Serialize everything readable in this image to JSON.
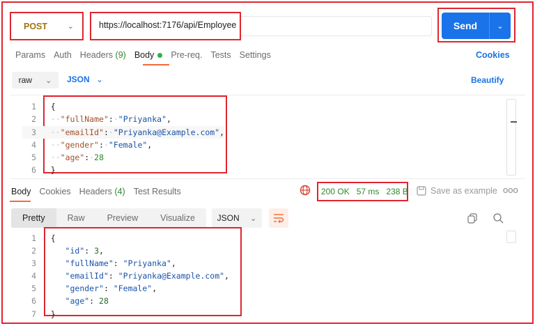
{
  "request": {
    "method": "POST",
    "url": "https://localhost:7176/api/Employee",
    "send_label": "Send"
  },
  "request_tabs": [
    {
      "label": "Params"
    },
    {
      "label": "Auth"
    },
    {
      "label": "Headers",
      "count": "(9)"
    },
    {
      "label": "Body"
    },
    {
      "label": "Pre-req."
    },
    {
      "label": "Tests"
    },
    {
      "label": "Settings"
    }
  ],
  "cookies_label": "Cookies",
  "body_mode": "raw",
  "body_format": "JSON",
  "beautify_label": "Beautify",
  "request_body": [
    {
      "n": "1",
      "text": "{"
    },
    {
      "n": "2",
      "key": "\"fullName\"",
      "val": "\"Priyanka\"",
      "type": "str"
    },
    {
      "n": "3",
      "key": "\"emailId\"",
      "val": "\"Priyanka@Example.com\"",
      "type": "str"
    },
    {
      "n": "4",
      "key": "\"gender\"",
      "val": "\"Female\"",
      "type": "str"
    },
    {
      "n": "5",
      "key": "\"age\"",
      "val": "28",
      "type": "num"
    },
    {
      "n": "6",
      "text": "}"
    }
  ],
  "response_tabs": [
    {
      "label": "Body"
    },
    {
      "label": "Cookies"
    },
    {
      "label": "Headers",
      "count": "(4)"
    },
    {
      "label": "Test Results"
    }
  ],
  "status": {
    "code": "200 OK",
    "time": "57 ms",
    "size": "238 B"
  },
  "save_example_label": "Save as example",
  "more_label": "ooo",
  "view_modes": [
    "Pretty",
    "Raw",
    "Preview",
    "Visualize"
  ],
  "response_format": "JSON",
  "response_body": [
    {
      "n": "1",
      "text": "{"
    },
    {
      "n": "2",
      "key": "\"id\"",
      "val": "3",
      "type": "num"
    },
    {
      "n": "3",
      "key": "\"fullName\"",
      "val": "\"Priyanka\"",
      "type": "str"
    },
    {
      "n": "4",
      "key": "\"emailId\"",
      "val": "\"Priyanka@Example.com\"",
      "type": "str"
    },
    {
      "n": "5",
      "key": "\"gender\"",
      "val": "\"Female\"",
      "type": "str"
    },
    {
      "n": "6",
      "key": "\"age\"",
      "val": "28",
      "type": "num"
    },
    {
      "n": "7",
      "text": "}"
    }
  ],
  "colors": {
    "highlight": "#e0252f",
    "send": "#1a73e8",
    "method": "#a0750e",
    "status": "#2c8a2c",
    "active_tab": "#f26b3a"
  }
}
